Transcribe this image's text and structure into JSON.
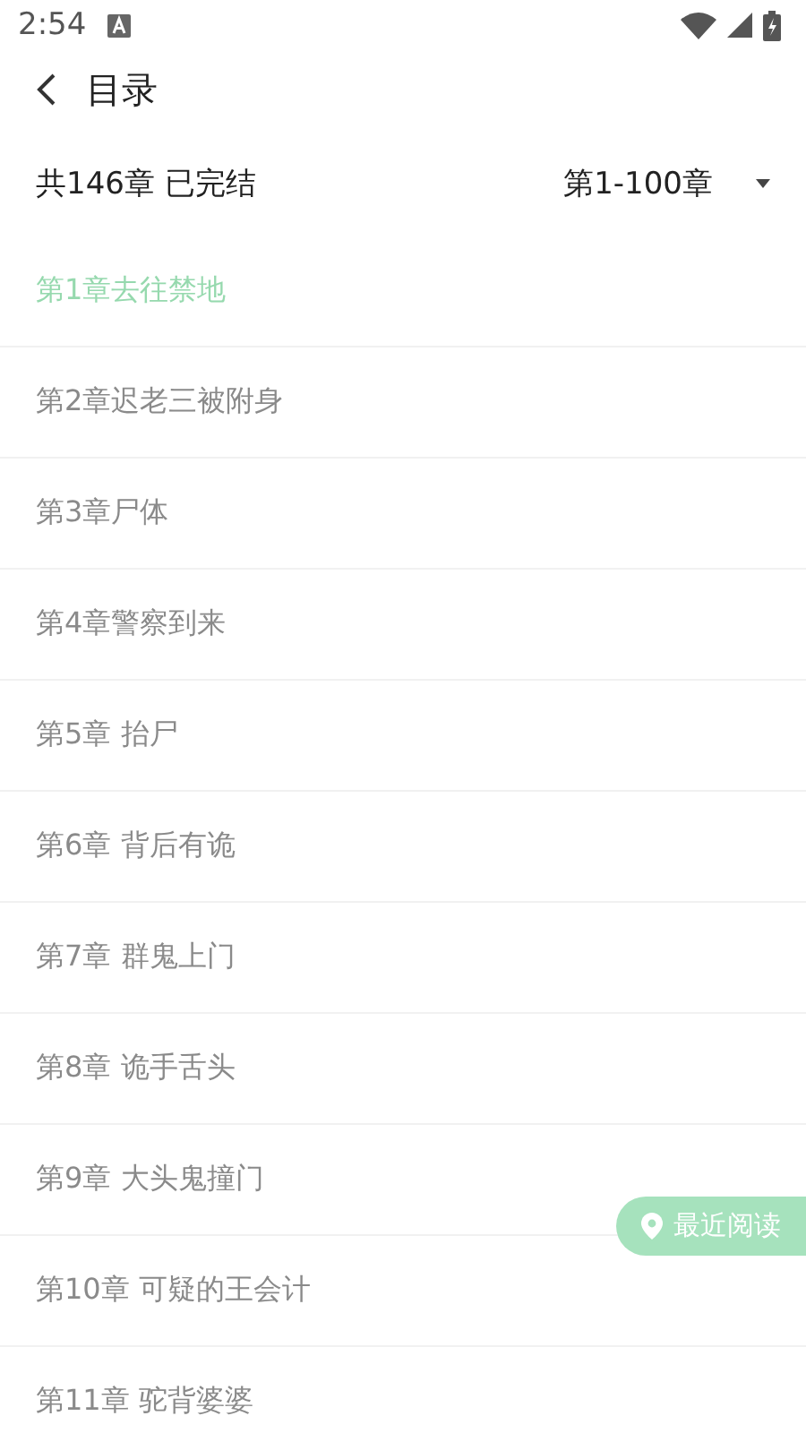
{
  "status_bar": {
    "time": "2:54"
  },
  "header": {
    "title": "目录"
  },
  "summary": {
    "info": "共146章 已完结",
    "range": "第1-100章"
  },
  "chapters": [
    {
      "title": "第1章去往禁地",
      "selected": true
    },
    {
      "title": "第2章迟老三被附身",
      "selected": false
    },
    {
      "title": "第3章尸体",
      "selected": false
    },
    {
      "title": "第4章警察到来",
      "selected": false
    },
    {
      "title": "第5章 抬尸",
      "selected": false
    },
    {
      "title": "第6章 背后有诡",
      "selected": false
    },
    {
      "title": "第7章 群鬼上门",
      "selected": false
    },
    {
      "title": "第8章 诡手舌头",
      "selected": false
    },
    {
      "title": "第9章 大头鬼撞门",
      "selected": false
    },
    {
      "title": "第10章 可疑的王会计",
      "selected": false
    },
    {
      "title": "第11章 驼背婆婆",
      "selected": false
    }
  ],
  "recent_button": {
    "label": "最近阅读"
  }
}
